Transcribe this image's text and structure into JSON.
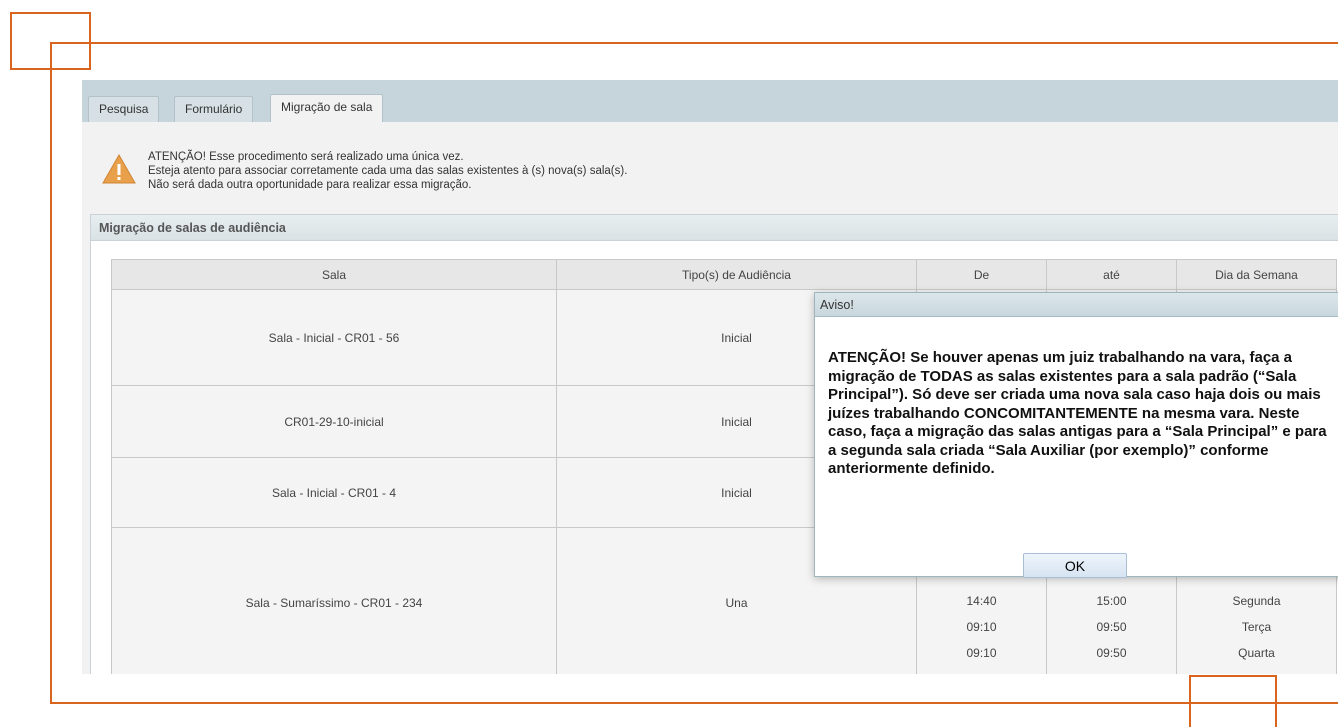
{
  "tabs": [
    {
      "label": "Pesquisa"
    },
    {
      "label": "Formulário"
    },
    {
      "label": "Migração de sala"
    }
  ],
  "warning": {
    "lines": [
      "ATENÇÃO! Esse procedimento será realizado uma única vez.",
      "Esteja atento para associar corretamente cada uma das salas existentes à (s) nova(s) sala(s).",
      "Não será dada outra oportunidade para realizar essa migração."
    ]
  },
  "section": {
    "title": "Migração de salas de audiência"
  },
  "table": {
    "headers": [
      "Sala",
      "Tipo(s) de Audiência",
      "De",
      "até",
      "Dia da Semana"
    ],
    "rows": [
      {
        "sala": "Sala - Inicial - CR01 - 56",
        "tipo": "Inicial"
      },
      {
        "sala": "CR01-29-10-inicial",
        "tipo": "Inicial"
      },
      {
        "sala": "Sala - Inicial - CR01 - 4",
        "tipo": "Inicial"
      },
      {
        "sala": "Sala - Sumaríssimo - CR01 - 234",
        "tipo": "Una",
        "de": [
          "14:40",
          "09:10",
          "09:10"
        ],
        "ate": [
          "15:00",
          "09:50",
          "09:50"
        ],
        "dia": [
          "Segunda",
          "Terça",
          "Quarta"
        ]
      }
    ]
  },
  "dialog": {
    "title": "Aviso!",
    "message": "ATENÇÃO! Se houver apenas um juiz trabalhando na vara, faça a migração de TODAS as salas existentes para a sala padrão (“Sala Principal”). Só deve ser criada uma nova sala caso haja dois ou mais juízes trabalhando CONCOMITANTEMENTE na mesma vara. Neste caso, faça a migração das salas antigas para a “Sala Principal” e para a segunda sala criada “Sala Auxiliar (por exemplo)” conforme anteriormente definido.",
    "ok_label": "OK"
  },
  "colors": {
    "frame": "#d9641e",
    "tabbar": "#c6d5db",
    "warning_icon": "#e8a04a"
  },
  "icons": {
    "warning": "warning-triangle-icon"
  }
}
